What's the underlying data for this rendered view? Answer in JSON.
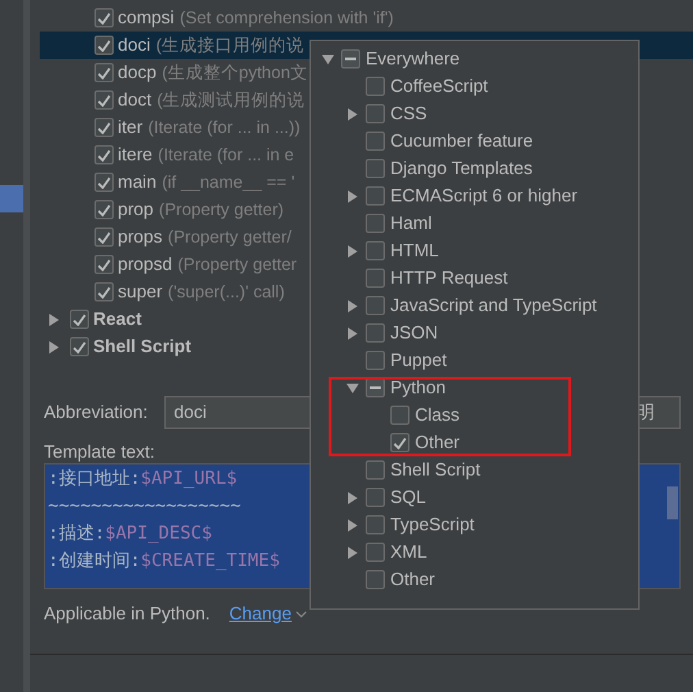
{
  "template_tree": [
    {
      "kind": "template",
      "abbreviation": "compsi",
      "description": "(Set comprehension with 'if')",
      "checked": true,
      "selected": false
    },
    {
      "kind": "template",
      "abbreviation": "doci",
      "description": "(生成接口用例的说",
      "checked": true,
      "selected": true
    },
    {
      "kind": "template",
      "abbreviation": "docp",
      "description": "(生成整个python文",
      "checked": true,
      "selected": false
    },
    {
      "kind": "template",
      "abbreviation": "doct",
      "description": "(生成测试用例的说",
      "checked": true,
      "selected": false
    },
    {
      "kind": "template",
      "abbreviation": "iter",
      "description": "(Iterate (for ... in ...))",
      "checked": true,
      "selected": false
    },
    {
      "kind": "template",
      "abbreviation": "itere",
      "description": "(Iterate (for ... in e",
      "checked": true,
      "selected": false
    },
    {
      "kind": "template",
      "abbreviation": "main",
      "description": "(if __name__ == '",
      "checked": true,
      "selected": false
    },
    {
      "kind": "template",
      "abbreviation": "prop",
      "description": "(Property getter)",
      "checked": true,
      "selected": false
    },
    {
      "kind": "template",
      "abbreviation": "props",
      "description": "(Property getter/",
      "checked": true,
      "selected": false
    },
    {
      "kind": "template",
      "abbreviation": "propsd",
      "description": "(Property getter",
      "checked": true,
      "selected": false
    },
    {
      "kind": "template",
      "abbreviation": "super",
      "description": "('super(...)' call)",
      "checked": true,
      "selected": false
    },
    {
      "kind": "group",
      "abbreviation": "React",
      "checked": true,
      "selected": false,
      "expanded": false
    },
    {
      "kind": "group",
      "abbreviation": "Shell Script",
      "checked": true,
      "selected": false,
      "expanded": false
    }
  ],
  "form": {
    "abbreviation_label": "Abbreviation:",
    "abbreviation_value": "doci",
    "description_value": "明",
    "template_label": "Template text:",
    "template_lines": [
      [
        {
          "kind": "text",
          "text": ":接口地址:"
        },
        {
          "kind": "variable",
          "text": "$API_URL$"
        }
      ],
      [
        {
          "kind": "text",
          "text": "~~~~~~~~~~~~~~~~~~"
        }
      ],
      [
        {
          "kind": "text",
          "text": ":描述:"
        },
        {
          "kind": "variable",
          "text": "$API_DESC$"
        }
      ],
      [
        {
          "kind": "text",
          "text": ":创建时间:"
        },
        {
          "kind": "variable",
          "text": "$CREATE_TIME$"
        }
      ]
    ],
    "applicable_text": "Applicable in Python.",
    "change_link": "Change"
  },
  "context_popup": [
    {
      "label": "Everywhere",
      "kind": "branch",
      "expanded": true,
      "checked": false,
      "partial": true,
      "highlighted": false,
      "children": [
        {
          "label": "CoffeeScript",
          "kind": "leaf",
          "checked": false,
          "partial": false,
          "highlighted": false
        },
        {
          "label": "CSS",
          "kind": "branch",
          "expanded": false,
          "checked": false,
          "partial": false,
          "highlighted": false
        },
        {
          "label": "Cucumber feature",
          "kind": "leaf",
          "checked": false,
          "partial": false,
          "highlighted": false
        },
        {
          "label": "Django Templates",
          "kind": "leaf",
          "checked": false,
          "partial": false,
          "highlighted": false
        },
        {
          "label": "ECMAScript 6 or higher",
          "kind": "branch",
          "expanded": false,
          "checked": false,
          "partial": false,
          "highlighted": false
        },
        {
          "label": "Haml",
          "kind": "leaf",
          "checked": false,
          "partial": false,
          "highlighted": false
        },
        {
          "label": "HTML",
          "kind": "branch",
          "expanded": false,
          "checked": false,
          "partial": false,
          "highlighted": false
        },
        {
          "label": "HTTP Request",
          "kind": "leaf",
          "checked": false,
          "partial": false,
          "highlighted": false
        },
        {
          "label": "JavaScript and TypeScript",
          "kind": "branch",
          "expanded": false,
          "checked": false,
          "partial": false,
          "highlighted": false
        },
        {
          "label": "JSON",
          "kind": "branch",
          "expanded": false,
          "checked": false,
          "partial": false,
          "highlighted": false
        },
        {
          "label": "Puppet",
          "kind": "leaf",
          "checked": false,
          "partial": false,
          "highlighted": false
        },
        {
          "label": "Python",
          "kind": "branch",
          "expanded": true,
          "checked": false,
          "partial": true,
          "highlighted": true,
          "children": [
            {
              "label": "Class",
              "kind": "leaf",
              "checked": false,
              "partial": false,
              "highlighted": false
            },
            {
              "label": "Other",
              "kind": "leaf",
              "checked": true,
              "partial": false,
              "highlighted": false
            }
          ]
        },
        {
          "label": "Shell Script",
          "kind": "leaf",
          "checked": false,
          "partial": false,
          "highlighted": false
        },
        {
          "label": "SQL",
          "kind": "branch",
          "expanded": false,
          "checked": false,
          "partial": false,
          "highlighted": false
        },
        {
          "label": "TypeScript",
          "kind": "branch",
          "expanded": false,
          "checked": false,
          "partial": false,
          "highlighted": false
        },
        {
          "label": "XML",
          "kind": "branch",
          "expanded": false,
          "checked": false,
          "partial": false,
          "highlighted": false
        },
        {
          "label": "Other",
          "kind": "leaf",
          "checked": false,
          "partial": false,
          "highlighted": false
        }
      ]
    }
  ]
}
